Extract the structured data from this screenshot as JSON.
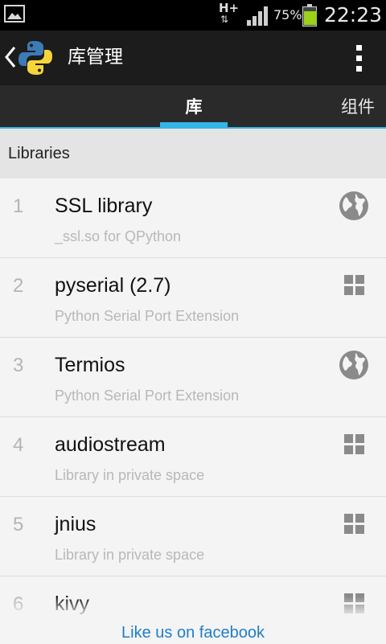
{
  "status_bar": {
    "image_icon": "image-notification-icon",
    "network_type": "H+",
    "network_arrows": "⇅",
    "signal_icon": "signal-strength-icon",
    "battery_percent": "75%",
    "battery_level": 0.75,
    "battery_color": "#9bd11a",
    "time": "22:23"
  },
  "action_bar": {
    "back_icon": "back-chevron-icon",
    "logo_icon": "python-logo-icon",
    "title": "库管理",
    "overflow_icon": "overflow-menu-icon"
  },
  "tabs": [
    {
      "label": "库",
      "selected": true
    },
    {
      "label": "组件",
      "selected": false
    }
  ],
  "accent_color": "#33b5e5",
  "section_header": "Libraries",
  "libraries": [
    {
      "number": "1",
      "title": "SSL library",
      "description": "_ssl.so for QPython",
      "icon": "globe-icon"
    },
    {
      "number": "2",
      "title": "pyserial (2.7)",
      "description": "Python Serial Port Extension",
      "icon": "grid-icon"
    },
    {
      "number": "3",
      "title": "Termios",
      "description": "Python Serial Port Extension",
      "icon": "globe-icon"
    },
    {
      "number": "4",
      "title": "audiostream",
      "description": "Library in private space",
      "icon": "grid-icon"
    },
    {
      "number": "5",
      "title": "jnius",
      "description": "Library in private space",
      "icon": "grid-icon"
    },
    {
      "number": "6",
      "title": "kivy",
      "description": "",
      "icon": "grid-icon"
    }
  ],
  "footer_link": "Like us on facebook",
  "link_color": "#1e7ec8"
}
